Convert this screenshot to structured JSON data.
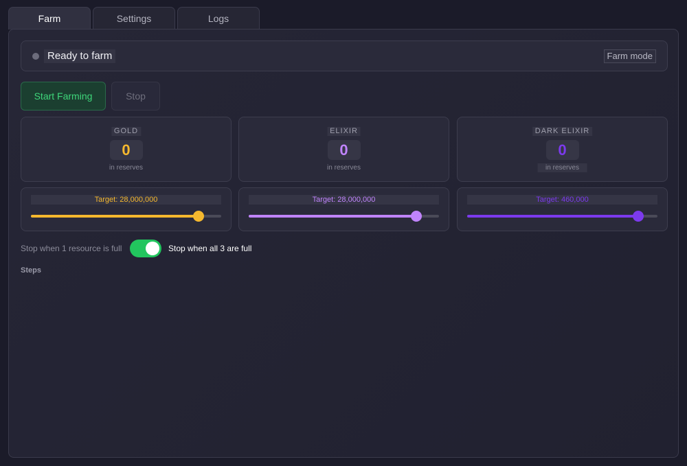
{
  "tabs": [
    {
      "label": "Farm",
      "active": true
    },
    {
      "label": "Settings",
      "active": false
    },
    {
      "label": "Logs",
      "active": false
    }
  ],
  "status": {
    "text": "Ready to farm",
    "mode": "Farm mode",
    "indicator_color": "#6c6c7c"
  },
  "buttons": {
    "start": "Start Farming",
    "stop": "Stop"
  },
  "resources": [
    {
      "name": "GOLD",
      "value": "0",
      "sub": "in reserves",
      "color": "#f5b82e"
    },
    {
      "name": "ELIXIR",
      "value": "0",
      "sub": "in reserves",
      "color": "#c084fc"
    },
    {
      "name": "DARK ELIXIR",
      "value": "0",
      "sub": "in reserves",
      "color": "#7c3aed"
    }
  ],
  "targets": [
    {
      "label": "Target: 28,000,000",
      "fraction": 0.88,
      "color": "#f5b82e"
    },
    {
      "label": "Target: 28,000,000",
      "fraction": 0.88,
      "color": "#c084fc"
    },
    {
      "label": "Target: 460,000",
      "fraction": 0.9,
      "color": "#7c3aed"
    }
  ],
  "stop_condition": {
    "left_label": "Stop when 1 resource is full",
    "right_label": "Stop when all 3 are full",
    "toggle_on": true
  },
  "steps": {
    "label": "Steps"
  }
}
